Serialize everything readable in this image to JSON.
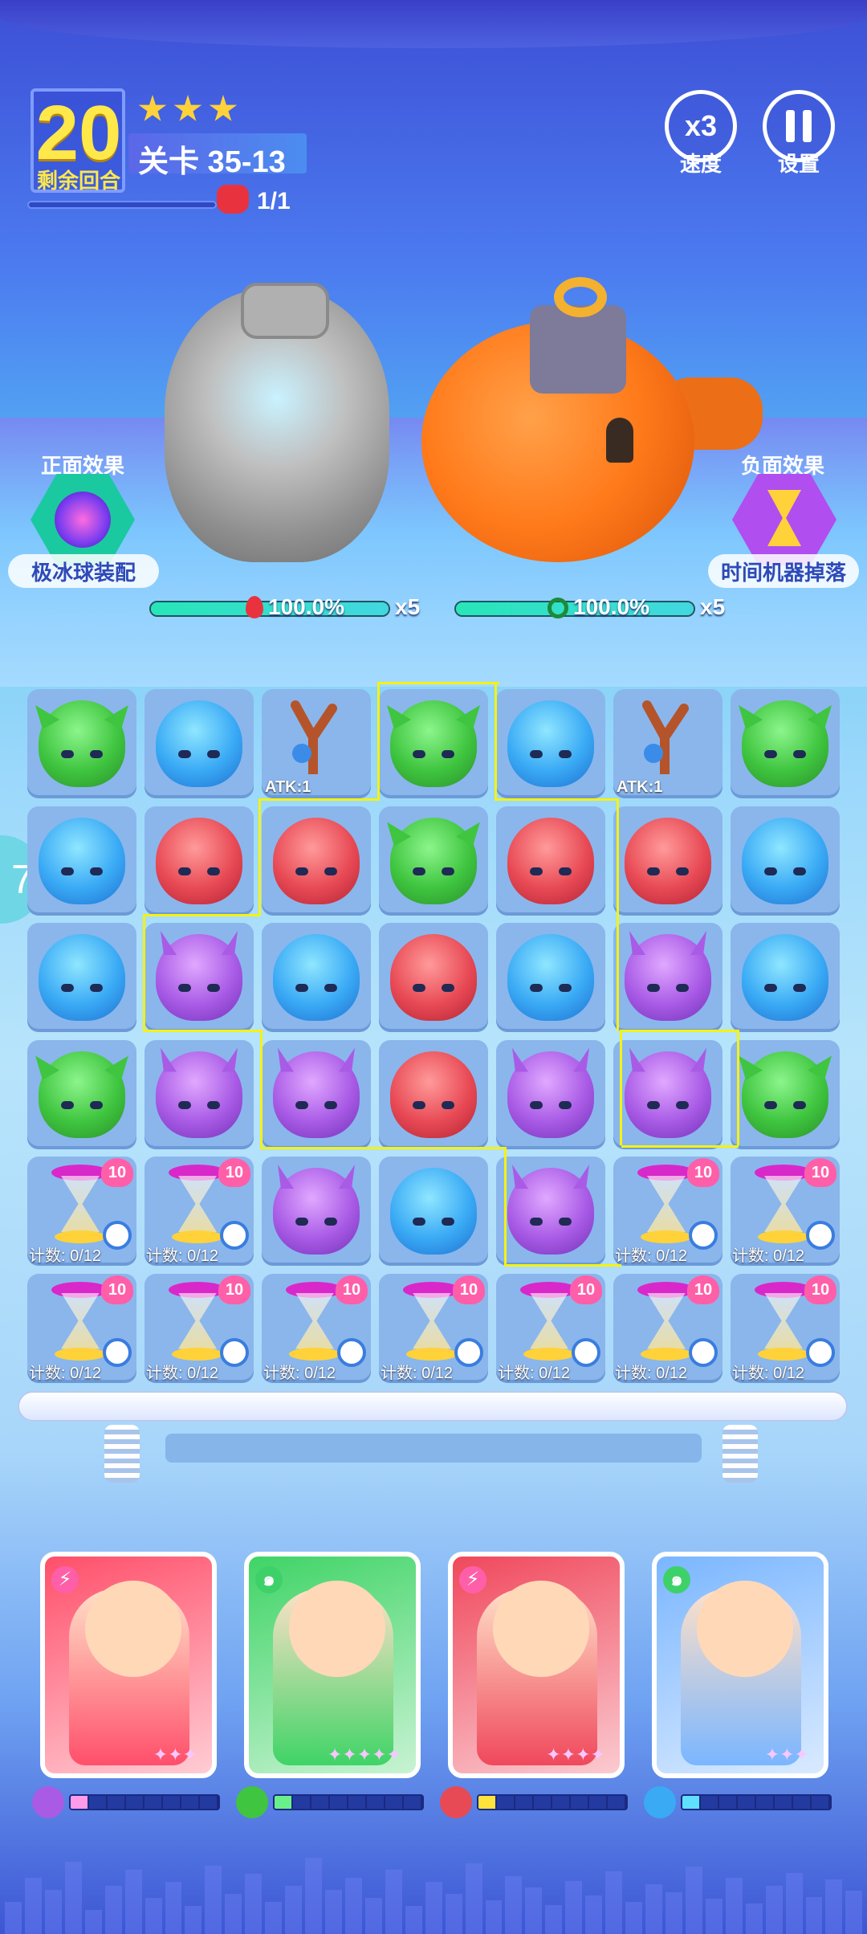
{
  "hud": {
    "rounds_left": "20",
    "rounds_label": "剩余回合",
    "level": "关卡 35-13",
    "stars_earned": 3,
    "enemy_count": "1/1",
    "speed_button": "x3",
    "speed_label": "速度",
    "settings_label": "设置"
  },
  "effects": {
    "positive_title": "正面效果",
    "positive_name": "极冰球装配",
    "negative_title": "负面效果",
    "negative_name": "时间机器掉落"
  },
  "enemies": [
    {
      "name": "rock-golem",
      "hp_text": "100.0%",
      "multiplier": "x5",
      "element": "fire",
      "hp_fraction": 1.0
    },
    {
      "name": "orange-robot",
      "hp_text": "100.0%",
      "multiplier": "x5",
      "element": "wind",
      "hp_fraction": 1.0
    }
  ],
  "side_tab": "7",
  "board": {
    "rows": [
      [
        "green",
        "blue",
        "slingshot",
        "green",
        "blue",
        "slingshot",
        "green"
      ],
      [
        "blue",
        "red",
        "red",
        "green",
        "red",
        "red",
        "blue"
      ],
      [
        "blue",
        "purple",
        "blue",
        "red",
        "blue",
        "purple",
        "blue"
      ],
      [
        "green",
        "purple",
        "purple",
        "red",
        "purple",
        "purple",
        "green"
      ],
      [
        "hourglass",
        "hourglass",
        "purple",
        "blue",
        "purple",
        "hourglass",
        "hourglass"
      ],
      [
        "hourglass",
        "hourglass",
        "hourglass",
        "hourglass",
        "hourglass",
        "hourglass",
        "hourglass"
      ]
    ],
    "slingshot_label": "ATK:1",
    "hourglass_badge": "10",
    "hourglass_count": "计数: 0/12"
  },
  "heroes": [
    {
      "name": "caveman-hero",
      "element": "lightning",
      "stars": "✦✦✦",
      "bg": "#ff4f6a",
      "energy_fill": 1,
      "energy_color": "#ff9be8"
    },
    {
      "name": "goggles-hero",
      "element": "wind",
      "stars": "✦✦✦✦✦",
      "bg": "#3fd466",
      "energy_fill": 1,
      "energy_color": "#6af08a"
    },
    {
      "name": "helmet-hero",
      "element": "lightning",
      "stars": "✦✦✦✦",
      "bg": "#f0485c",
      "energy_fill": 1,
      "energy_color": "#ffe23a"
    },
    {
      "name": "maid-hero",
      "element": "wind",
      "stars": "✦✦✦",
      "bg": "#7ab6ff",
      "energy_fill": 1,
      "energy_color": "#5fe0ff"
    }
  ],
  "colors": {
    "star": "#ffd23a",
    "path_highlight": "#f4f215",
    "rounds_text": "#ffe84a"
  }
}
